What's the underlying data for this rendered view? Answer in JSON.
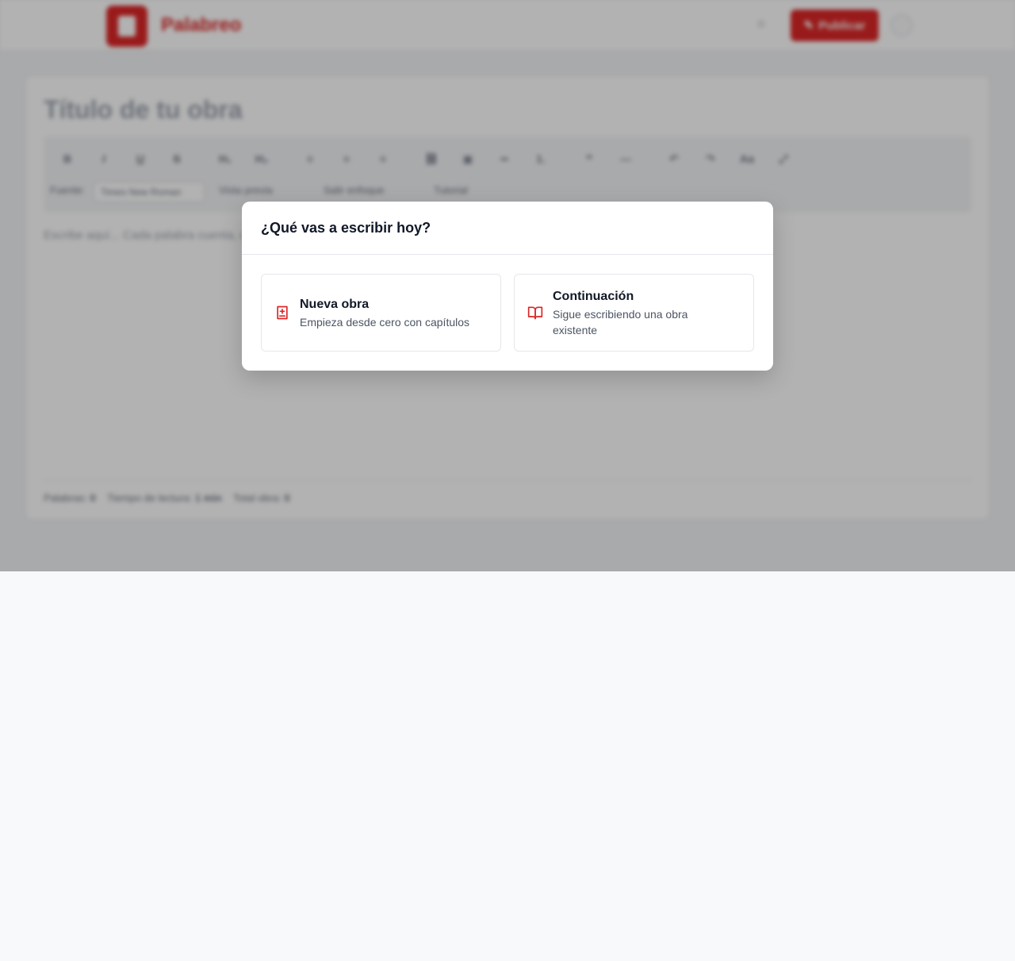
{
  "app": {
    "brand": "Palabreo",
    "publish_label": "Publicar",
    "publish_icon": "pen-icon",
    "notification_icon": "bell-icon"
  },
  "editor": {
    "title_placeholder": "Título de tu obra",
    "toolbar": {
      "buttons": [
        "B",
        "I",
        "U",
        "S",
        "H₁",
        "H₂",
        "≡",
        "≡",
        "≡",
        "⛓",
        "▣",
        "••",
        "1.",
        "❝",
        "—",
        "↶",
        "↷",
        "Aa",
        "⤢"
      ],
      "font_label": "Fuente:",
      "font_value": "Times New Roman",
      "preview_label": "Vista previa",
      "focus_label": "Salir enfoque",
      "tutorial_label": "Tutorial"
    },
    "body_placeholder": "Escribe aquí... Cada palabra cuenta, cada historia importa.",
    "stats": {
      "words_label": "Palabras:",
      "words_value": "0",
      "reading_label": "Tiempo de lectura:",
      "reading_value": "1 min",
      "total_label": "Total obra:",
      "total_value": "0"
    }
  },
  "modal": {
    "title": "¿Qué vas a escribir hoy?",
    "options": [
      {
        "icon": "book-plus-icon",
        "title": "Nueva obra",
        "description": "Empieza desde cero con capítulos"
      },
      {
        "icon": "open-book-icon",
        "title": "Continuación",
        "description": "Sigue escribiendo una obra existente"
      }
    ]
  },
  "colors": {
    "accent": "#dc2626",
    "text": "#111827",
    "muted": "#4b5563",
    "border": "#e5e7eb",
    "page_bg": "#f8f9fb"
  }
}
